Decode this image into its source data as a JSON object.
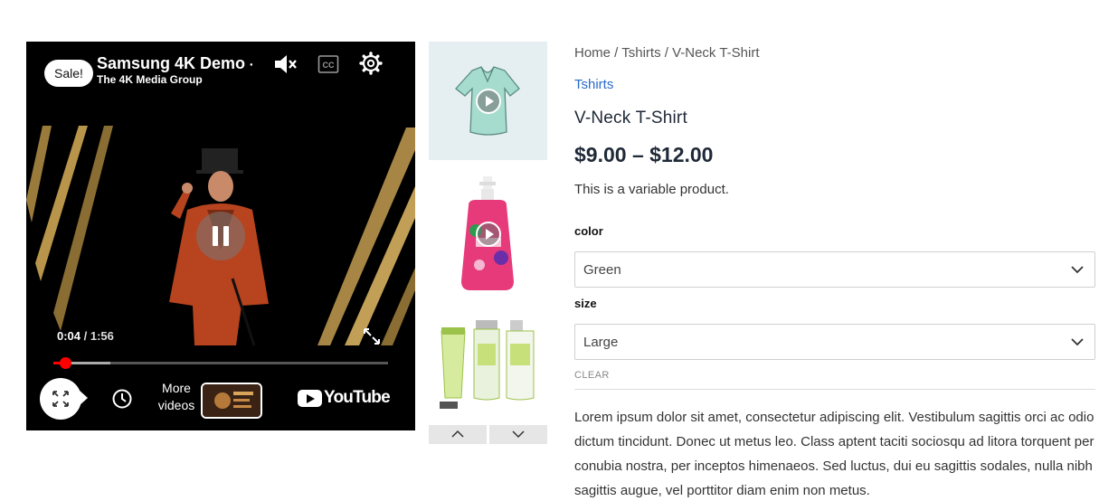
{
  "video": {
    "badge": "Sale!",
    "title": "Samsung 4K Demo - ",
    "channel": "The 4K Media Group",
    "current_time": "0:04",
    "separator": " / ",
    "duration": "1:56",
    "progress_fraction": 0.034,
    "buffer_fraction": 0.17,
    "more_videos_label": "More videos",
    "youtube_logo_text": "YouTube"
  },
  "thumbnails": [
    {
      "name": "t-shirt",
      "has_video": true
    },
    {
      "name": "hand-soap",
      "has_video": true
    },
    {
      "name": "skincare-set",
      "has_video": false
    }
  ],
  "product": {
    "breadcrumb": "Home / Tshirts / V-Neck T-Shirt",
    "category": "Tshirts",
    "title": "V-Neck T-Shirt",
    "price": "$9.00 – $12.00",
    "short_description": "This is a variable product.",
    "attributes": [
      {
        "label": "color",
        "value": "Green"
      },
      {
        "label": "size",
        "value": "Large"
      }
    ],
    "clear_label": "CLEAR",
    "description": "Lorem ipsum dolor sit amet, consectetur adipiscing elit. Vestibulum sagittis orci ac odio dictum tincidunt. Donec ut metus leo. Class aptent taciti sociosqu ad litora torquent per conubia nostra, per inceptos himenaeos. Sed luctus, dui eu sagittis sodales, nulla nibh sagittis augue, vel porttitor diam enim non metus."
  },
  "colors": {
    "link": "#2a6bc9",
    "progress": "#ff0000",
    "thumb_bg": "#e5eff1"
  }
}
